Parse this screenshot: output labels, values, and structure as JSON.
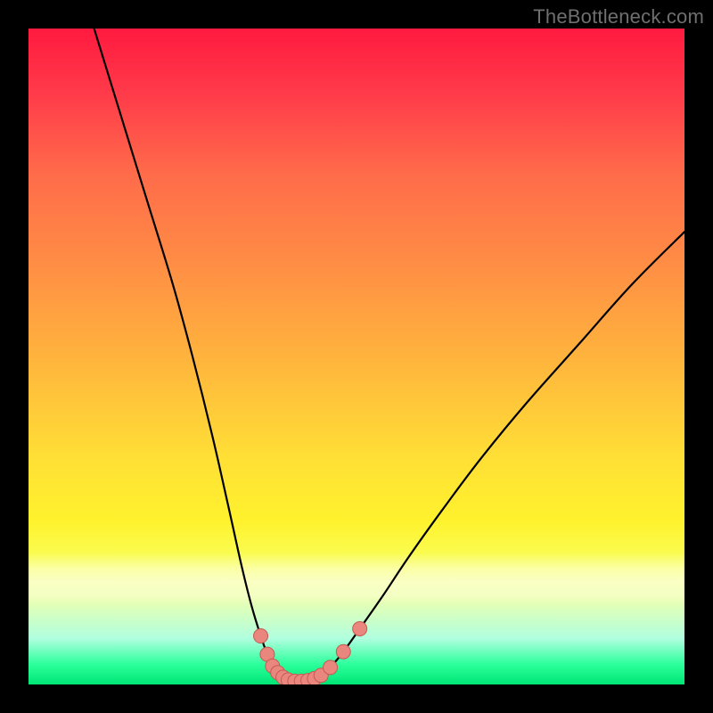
{
  "watermark": {
    "text": "TheBottleneck.com"
  },
  "colors": {
    "frame": "#000000",
    "curve_stroke": "#000000",
    "marker_fill": "#e9867e",
    "marker_stroke": "#c55a53",
    "gradient_top": "#ff1a3f",
    "gradient_bottom": "#00e675"
  },
  "chart_data": {
    "type": "line",
    "title": "",
    "xlabel": "",
    "ylabel": "",
    "xlim": [
      0,
      100
    ],
    "ylim": [
      0,
      100
    ],
    "grid": false,
    "legend": false,
    "series": [
      {
        "name": "left-branch",
        "x": [
          10,
          14,
          18,
          22,
          25,
          28,
          30.5,
          32.5,
          34,
          35.4,
          36.4,
          37.2,
          38,
          38.8,
          39.6
        ],
        "y": [
          100,
          87,
          74,
          61,
          50,
          38,
          27,
          18,
          12,
          7.4,
          4.6,
          2.8,
          1.8,
          1.1,
          0.7
        ]
      },
      {
        "name": "valley-floor",
        "x": [
          39.6,
          40.6,
          41.6,
          42.6,
          43.6
        ],
        "y": [
          0.7,
          0.5,
          0.5,
          0.6,
          0.9
        ]
      },
      {
        "name": "right-branch",
        "x": [
          43.6,
          44.6,
          46,
          48,
          50.5,
          54,
          58,
          63,
          69,
          76,
          84,
          92,
          100
        ],
        "y": [
          0.9,
          1.4,
          2.6,
          5.0,
          8.5,
          13.5,
          19.5,
          26.5,
          34.5,
          43,
          52,
          61,
          69
        ]
      }
    ],
    "markers": {
      "name": "salmon-dots",
      "points": [
        {
          "x": 35.4,
          "y": 7.4
        },
        {
          "x": 36.4,
          "y": 4.6
        },
        {
          "x": 37.2,
          "y": 2.8
        },
        {
          "x": 38.0,
          "y": 1.8
        },
        {
          "x": 38.8,
          "y": 1.1
        },
        {
          "x": 39.6,
          "y": 0.7
        },
        {
          "x": 40.6,
          "y": 0.5
        },
        {
          "x": 41.6,
          "y": 0.5
        },
        {
          "x": 42.6,
          "y": 0.6
        },
        {
          "x": 43.6,
          "y": 0.9
        },
        {
          "x": 44.6,
          "y": 1.4
        },
        {
          "x": 46.0,
          "y": 2.6
        },
        {
          "x": 48.0,
          "y": 5.0
        },
        {
          "x": 50.5,
          "y": 8.5
        }
      ]
    },
    "annotations": []
  }
}
